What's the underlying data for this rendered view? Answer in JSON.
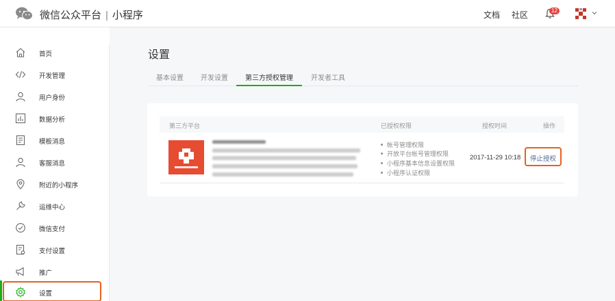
{
  "header": {
    "brand_name": "微信公众平台",
    "separator": "|",
    "product": "小程序",
    "docs_label": "文档",
    "community_label": "社区",
    "notification_count": "12"
  },
  "sidebar": {
    "items": [
      {
        "label": "首页",
        "icon": "home-icon"
      },
      {
        "label": "开发管理",
        "icon": "code-icon"
      },
      {
        "label": "用户身份",
        "icon": "user-icon"
      },
      {
        "label": "数据分析",
        "icon": "chart-icon"
      },
      {
        "label": "模板消息",
        "icon": "template-icon"
      },
      {
        "label": "客服消息",
        "icon": "customer-service-icon"
      },
      {
        "label": "附近的小程序",
        "icon": "location-pin-icon"
      },
      {
        "label": "运维中心",
        "icon": "wrench-icon"
      },
      {
        "label": "微信支付",
        "icon": "payment-icon"
      },
      {
        "label": "支付设置",
        "icon": "payment-settings-icon"
      },
      {
        "label": "推广",
        "icon": "megaphone-icon"
      },
      {
        "label": "设置",
        "icon": "gear-icon"
      }
    ],
    "active_item": "设置"
  },
  "main": {
    "title": "设置",
    "tabs": [
      {
        "label": "基本设置"
      },
      {
        "label": "开发设置"
      },
      {
        "label": "第三方授权管理"
      },
      {
        "label": "开发者工具"
      }
    ],
    "active_tab": "第三方授权管理",
    "table": {
      "columns": [
        "第三方平台",
        "已授权权限",
        "授权时间",
        "操作"
      ],
      "rows": [
        {
          "permissions": [
            "帐号管理权限",
            "开放平台帐号管理权限",
            "小程序基本信息设置权限",
            "小程序认证权限"
          ],
          "auth_time": "2017-11-29 10:18",
          "action_label": "停止授权"
        }
      ]
    }
  },
  "colors": {
    "accent_green": "#1aad19",
    "highlight_orange": "#e5601f",
    "link_blue": "#576b95",
    "app_logo_red": "#e64c32",
    "badge_red": "#e64340"
  }
}
